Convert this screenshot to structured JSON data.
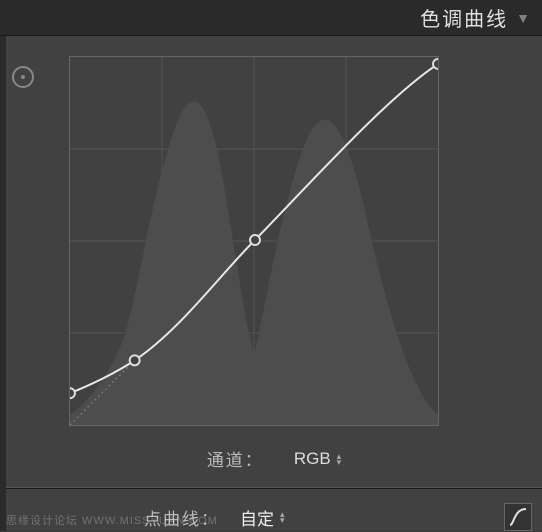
{
  "header": {
    "title": "色调曲线"
  },
  "channel": {
    "label": "通道：",
    "value": "RGB"
  },
  "pointcurve": {
    "label": "点曲线：",
    "value": "自定"
  },
  "watermark": "思缘设计论坛  WWW.MISSYUAN.COM",
  "chart_data": {
    "type": "line",
    "title": "色调曲线",
    "xlabel": "",
    "ylabel": "",
    "xlim": [
      0,
      255
    ],
    "ylim": [
      0,
      255
    ],
    "series": [
      {
        "name": "curve",
        "x": [
          0,
          45,
          128,
          255
        ],
        "y": [
          22,
          45,
          128,
          250
        ]
      }
    ],
    "histogram_peaks_approx": [
      {
        "x": 80,
        "h": 0.85
      },
      {
        "x": 190,
        "h": 0.78
      }
    ]
  }
}
